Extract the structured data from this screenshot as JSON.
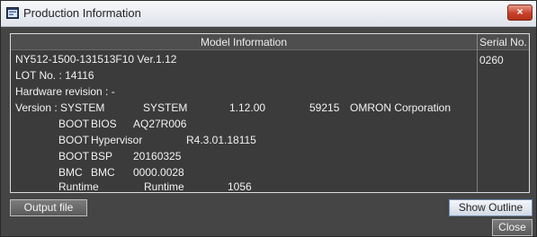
{
  "window": {
    "title": "Production Information",
    "close_glyph": "×"
  },
  "table": {
    "header_model": "Model Information",
    "header_serial": "Serial No.",
    "model_line": "NY512-1500-131513F10 Ver.1.12",
    "lot_line": "LOT No. : 14116",
    "hw_line": "Hardware revision : -",
    "version_rows": [
      {
        "c1": "Version : SYSTEM",
        "c2": "SYSTEM",
        "c3": "1.12.00",
        "c4": "59215",
        "c5": "OMRON Corporation"
      },
      {
        "c1": "BOOT",
        "c2": "BIOS",
        "c3": "AQ27R006"
      },
      {
        "c1": "BOOT",
        "c2": "Hypervisor",
        "c3": "R4.3.01.18115"
      },
      {
        "c1": "BOOT",
        "c2": "BSP",
        "c3": "20160325"
      },
      {
        "c1": "BMC",
        "c2": "BMC",
        "c3": "0000.0028"
      },
      {
        "c1": "Runtime",
        "c2": "Runtime",
        "c3": "1056"
      }
    ],
    "serial_value": "0260"
  },
  "buttons": {
    "output_file": "Output file",
    "show_outline": "Show Outline",
    "close": "Close"
  },
  "colors": {
    "background": "#454545",
    "table_bg": "#3b3b3b",
    "header_bg": "#4e4e4e",
    "text": "#f2f2f2",
    "close_red": "#c8402a"
  }
}
